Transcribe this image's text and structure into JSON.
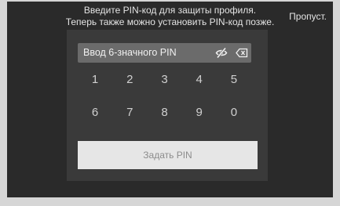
{
  "prompt": {
    "line1": "Введите PIN-код для защиты профиля.",
    "line2": "Теперь также можно установить PIN-код позже."
  },
  "skip_label": "Пропуст.",
  "pin_input": {
    "placeholder": "Ввод 6-значного PIN",
    "visibility_icon": "eye-off-icon",
    "delete_icon": "backspace-icon"
  },
  "keypad": {
    "row1": [
      "1",
      "2",
      "3",
      "4",
      "5"
    ],
    "row2": [
      "6",
      "7",
      "8",
      "9",
      "0"
    ]
  },
  "set_pin_label": "Задать PIN",
  "colors": {
    "background": "#2a2a2a",
    "card": "#3a3a3a",
    "input": "#6b6b6b",
    "button": "#e6e6e6"
  }
}
